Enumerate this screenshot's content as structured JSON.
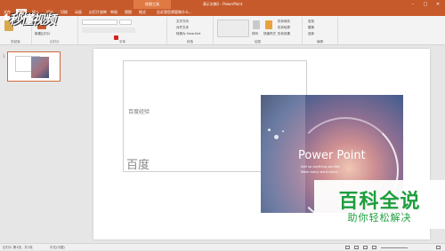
{
  "titlebar": {
    "contextual_tab": "绘图工具",
    "title": "演示文稿1 - PowerPoint",
    "minimize": "–",
    "maximize": "□",
    "close": "✕"
  },
  "tabs": [
    "文件",
    "开始",
    "插入",
    "设计",
    "切换",
    "动画",
    "幻灯片放映",
    "审阅",
    "视图",
    "格式"
  ],
  "tell_me": "告诉我您想要做什么...",
  "ribbon": {
    "groups": [
      "剪贴板",
      "幻灯片",
      "字体",
      "段落",
      "绘图",
      "编辑"
    ],
    "new_slide": "新建幻灯片",
    "text_direction": "文字方向",
    "align_text": "对齐文本",
    "smartart": "转换为 SmartArt",
    "arrange": "排列",
    "quick_styles": "快速样式",
    "shape_fill": "形状填充",
    "shape_outline": "形状轮廓",
    "shape_effects": "形状效果",
    "find": "查找",
    "replace": "替换",
    "select": "选择"
  },
  "watermark": "秒懂视频",
  "thumbnail": {
    "number": "1"
  },
  "slide": {
    "textbox_small": "百度经验",
    "textbox_big": "百度",
    "image_title": "Power Point",
    "image_sub1": "Add up anything you like",
    "image_sub2": "Make every word count..."
  },
  "badge": {
    "title": "百科全说",
    "subtitle": "助你轻松解决"
  },
  "statusbar": {
    "slide_info": "幻灯片 第1张，共1张",
    "language": "中文(中国)"
  },
  "colors": {
    "accent": "#c75a2b",
    "badge_green": "#1c9e3c"
  }
}
